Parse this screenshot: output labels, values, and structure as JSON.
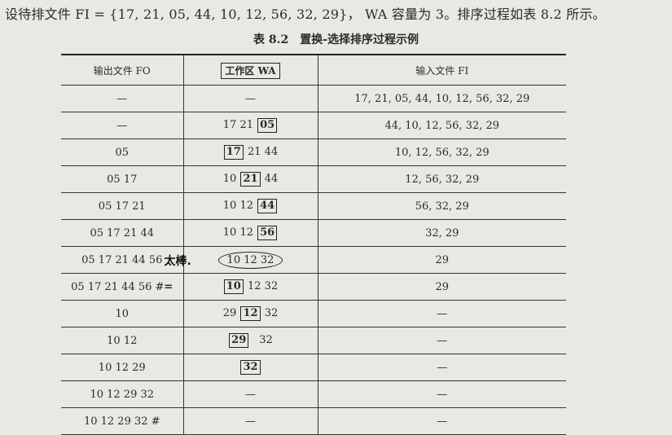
{
  "intro_text": "设待排文件 FI = {17, 21, 05, 44, 10, 12, 56, 32, 29}， WA 容量为 3。排序过程如表 8.2 所示。",
  "caption": {
    "number": "表 8.2",
    "title": "置换-选择排序过程示例"
  },
  "headers": {
    "fo": "输出文件 FO",
    "wa": "工作区 WA",
    "fi": "输入文件 FI"
  },
  "handwritten_note": "太棒.",
  "handwritten_mark": "=",
  "rows": [
    {
      "fo": "—",
      "wa": "—",
      "fi": "17, 21, 05, 44, 10, 12, 56, 32, 29"
    },
    {
      "fo": "—",
      "wa_parts": [
        "17 21",
        "05"
      ],
      "fi": "44, 10, 12, 56, 32, 29"
    },
    {
      "fo": "05",
      "wa_parts": [
        "17",
        "21 44"
      ],
      "fi": "10, 12, 56, 32, 29"
    },
    {
      "fo": "05 17",
      "wa_parts": [
        "10",
        "21",
        "44"
      ],
      "fi": "12, 56, 32, 29"
    },
    {
      "fo": "05 17 21",
      "wa_parts": [
        "10 12",
        "44"
      ],
      "fi": "56, 32, 29"
    },
    {
      "fo": "05 17 21 44",
      "wa_parts": [
        "10 12",
        "56"
      ],
      "fi": "32, 29"
    },
    {
      "fo": "05 17 21 44 56",
      "wa": "10 12 32",
      "fi": "29"
    },
    {
      "fo": "05 17 21 44 56 #",
      "wa_parts": [
        "10",
        "12 32"
      ],
      "fi": "29"
    },
    {
      "fo": "10",
      "wa_parts": [
        "29",
        "12",
        "32"
      ],
      "fi": "—"
    },
    {
      "fo": "10 12",
      "wa_parts": [
        "29",
        "32"
      ],
      "fi": "—"
    },
    {
      "fo": "10 12 29",
      "wa_parts": [
        "32"
      ],
      "fi": "—"
    },
    {
      "fo": "10 12 29 32",
      "wa": "—",
      "fi": "—"
    },
    {
      "fo": "10 12 29 32 #",
      "wa": "—",
      "fi": "—"
    }
  ]
}
